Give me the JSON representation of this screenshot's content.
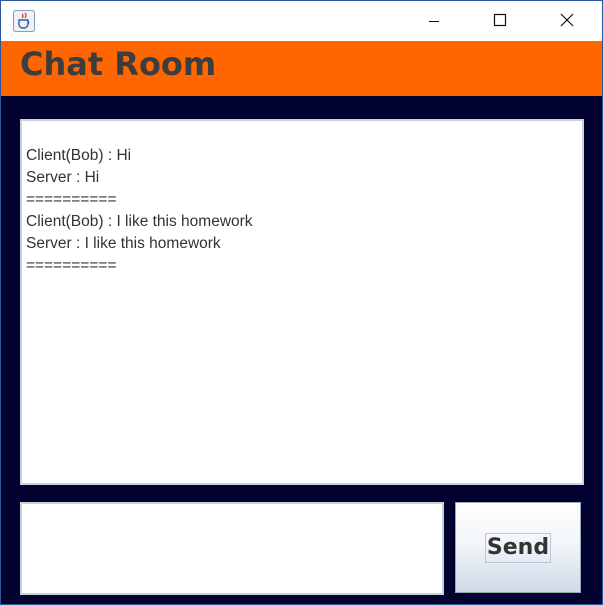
{
  "window": {
    "icon": "java-cup-icon",
    "controls": [
      "minimize-icon",
      "maximize-icon",
      "close-icon"
    ]
  },
  "header": {
    "title": "Chat Room",
    "background_color": "#ff6600",
    "text_color": "#3d3d3d"
  },
  "chat": {
    "lines": [
      "Client(Bob) : Hi",
      "Server : Hi",
      "==========",
      "Client(Bob) : I like this homework",
      "Server : I like this homework",
      "=========="
    ]
  },
  "input": {
    "value": "",
    "placeholder": ""
  },
  "send_button": {
    "label": "Send"
  },
  "colors": {
    "panel_background": "#020230",
    "field_border": "#c9d2de"
  }
}
